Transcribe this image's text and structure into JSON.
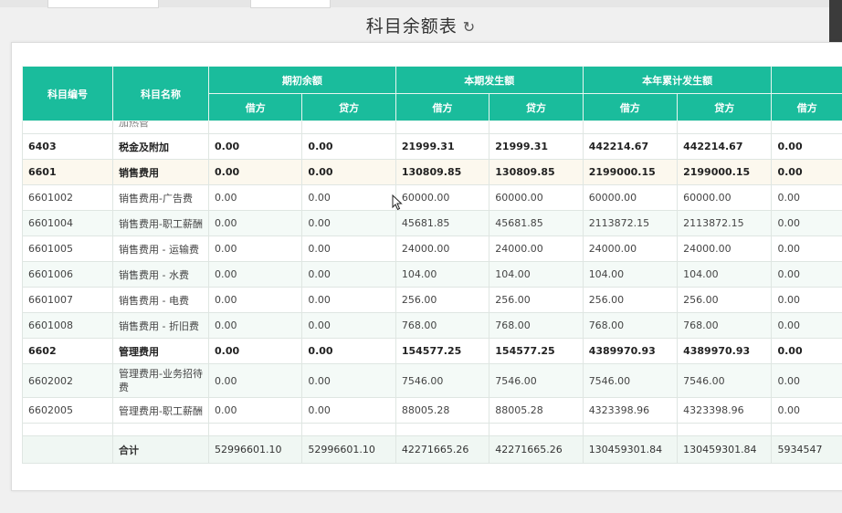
{
  "page": {
    "title": "科目余额表",
    "refresh_icon": "↻"
  },
  "table": {
    "headers": {
      "code": "科目编号",
      "name": "科目名称",
      "groups": [
        "期初余额",
        "本期发生额",
        "本年累计发生额"
      ],
      "debit": "借方",
      "credit": "贷方",
      "partial_debit": "借方"
    },
    "partial_row": {
      "name": "加热管"
    },
    "rows": [
      {
        "code": "6403",
        "name": "税金及附加",
        "v1": "0.00",
        "v2": "0.00",
        "v3": "21999.31",
        "v4": "21999.31",
        "v5": "442214.67",
        "v6": "442214.67",
        "v7": "0.00"
      },
      {
        "code": "6601",
        "name": "销售费用",
        "v1": "0.00",
        "v2": "0.00",
        "v3": "130809.85",
        "v4": "130809.85",
        "v5": "2199000.15",
        "v6": "2199000.15",
        "v7": "0.00"
      },
      {
        "code": "6601002",
        "name": "销售费用-广告费",
        "v1": "0.00",
        "v2": "0.00",
        "v3": "60000.00",
        "v4": "60000.00",
        "v5": "60000.00",
        "v6": "60000.00",
        "v7": "0.00"
      },
      {
        "code": "6601004",
        "name": "销售费用-职工薪酬",
        "v1": "0.00",
        "v2": "0.00",
        "v3": "45681.85",
        "v4": "45681.85",
        "v5": "2113872.15",
        "v6": "2113872.15",
        "v7": "0.00"
      },
      {
        "code": "6601005",
        "name": "销售费用 - 运输费",
        "v1": "0.00",
        "v2": "0.00",
        "v3": "24000.00",
        "v4": "24000.00",
        "v5": "24000.00",
        "v6": "24000.00",
        "v7": "0.00"
      },
      {
        "code": "6601006",
        "name": "销售费用 - 水费",
        "v1": "0.00",
        "v2": "0.00",
        "v3": "104.00",
        "v4": "104.00",
        "v5": "104.00",
        "v6": "104.00",
        "v7": "0.00"
      },
      {
        "code": "6601007",
        "name": "销售费用 - 电费",
        "v1": "0.00",
        "v2": "0.00",
        "v3": "256.00",
        "v4": "256.00",
        "v5": "256.00",
        "v6": "256.00",
        "v7": "0.00"
      },
      {
        "code": "6601008",
        "name": "销售费用 - 折旧费",
        "v1": "0.00",
        "v2": "0.00",
        "v3": "768.00",
        "v4": "768.00",
        "v5": "768.00",
        "v6": "768.00",
        "v7": "0.00"
      },
      {
        "code": "6602",
        "name": "管理费用",
        "v1": "0.00",
        "v2": "0.00",
        "v3": "154577.25",
        "v4": "154577.25",
        "v5": "4389970.93",
        "v6": "4389970.93",
        "v7": "0.00"
      },
      {
        "code": "6602002",
        "name": "管理费用-业务招待费",
        "v1": "0.00",
        "v2": "0.00",
        "v3": "7546.00",
        "v4": "7546.00",
        "v5": "7546.00",
        "v6": "7546.00",
        "v7": "0.00"
      },
      {
        "code": "6602005",
        "name": "管理费用-职工薪酬",
        "v1": "0.00",
        "v2": "0.00",
        "v3": "88005.28",
        "v4": "88005.28",
        "v5": "4323398.96",
        "v6": "4323398.96",
        "v7": "0.00"
      }
    ],
    "footer": {
      "label": "合计",
      "v1": "52996601.10",
      "v2": "52996601.10",
      "v3": "42271665.26",
      "v4": "42271665.26",
      "v5": "130459301.84",
      "v6": "130459301.84",
      "v7": "5934547"
    }
  }
}
